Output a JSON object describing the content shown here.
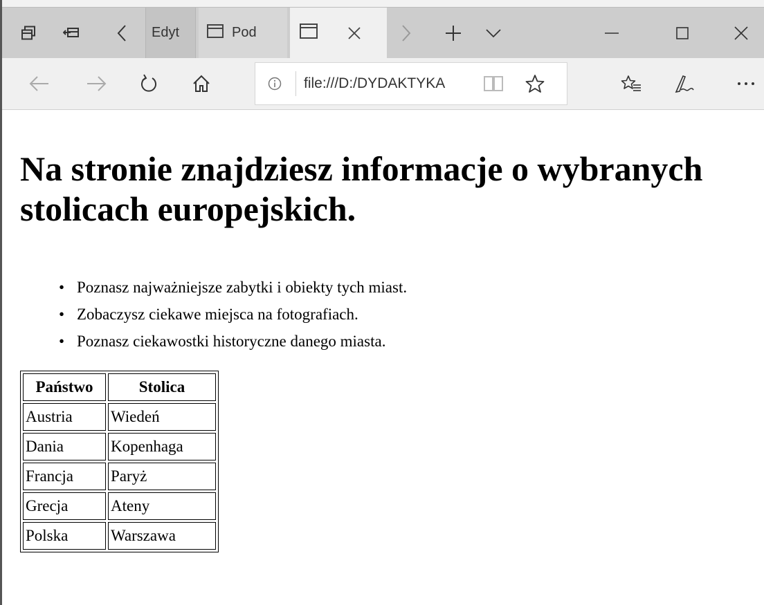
{
  "browser": {
    "tabs": [
      {
        "label": "Edyt"
      },
      {
        "label": "Pod"
      },
      {
        "label": ""
      }
    ],
    "address": {
      "url": "file:///D:/DYDAKTYKA"
    },
    "window_buttons": [
      "minimize",
      "maximize",
      "close"
    ],
    "icons": {
      "tab_preview": "tab-preview-icon",
      "set_aside": "set-aside-tabs-icon",
      "back": "back-arrow-icon",
      "forward": "forward-arrow-icon",
      "refresh": "refresh-icon",
      "home": "home-icon",
      "info": "info-icon",
      "reading": "reading-view-icon",
      "favorite": "star-icon",
      "favorites_hub": "favorites-hub-icon",
      "web_note": "pen-icon",
      "more": "more-icon"
    }
  },
  "page": {
    "title": "Na stronie znajdziesz informacje o wybranych stolicach europejskich.",
    "bullets": [
      "Poznasz najważniejsze zabytki i obiekty tych miast.",
      "Zobaczysz ciekawe miejsca na fotografiach.",
      "Poznasz ciekawostki historyczne danego miasta."
    ],
    "table": {
      "headers": [
        "Państwo",
        "Stolica"
      ],
      "rows": [
        [
          "Austria",
          "Wiedeń"
        ],
        [
          "Dania",
          "Kopenhaga"
        ],
        [
          "Francja",
          "Paryż"
        ],
        [
          "Grecja",
          "Ateny"
        ],
        [
          "Polska",
          "Warszawa"
        ]
      ]
    }
  }
}
